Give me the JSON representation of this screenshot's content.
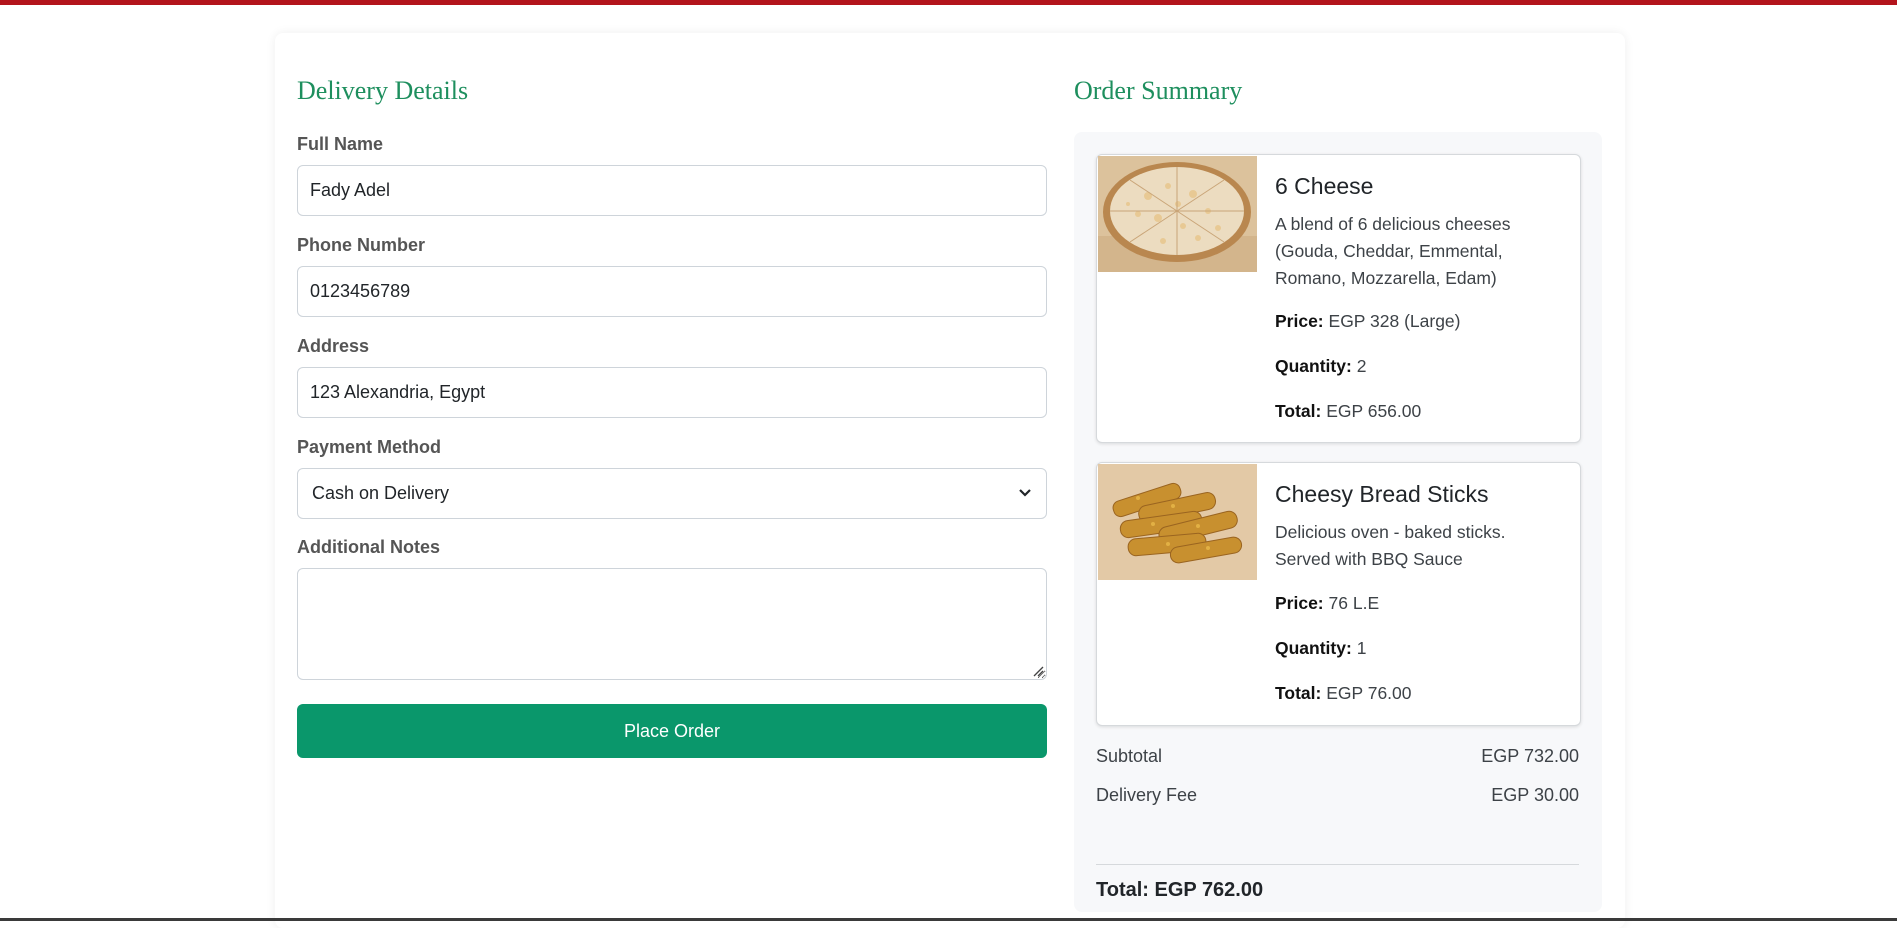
{
  "delivery": {
    "title": "Delivery Details",
    "full_name_label": "Full Name",
    "full_name_value": "Fady Adel",
    "phone_label": "Phone Number",
    "phone_value": "0123456789",
    "address_label": "Address",
    "address_value": "123 Alexandria, Egypt",
    "payment_label": "Payment Method",
    "payment_selected": "Cash on Delivery",
    "notes_label": "Additional Notes",
    "notes_value": "",
    "place_order_label": "Place Order"
  },
  "summary": {
    "title": "Order Summary",
    "items": [
      {
        "name": "6 Cheese",
        "description": "A blend of 6 delicious cheeses (Gouda, Cheddar, Emmental, Romano, Mozzarella, Edam)",
        "price_label": "Price:",
        "price": "EGP 328 (Large)",
        "quantity_label": "Quantity:",
        "quantity": "2",
        "total_label": "Total:",
        "total": "EGP 656.00"
      },
      {
        "name": "Cheesy Bread Sticks",
        "description": "Delicious oven - baked sticks. Served with BBQ Sauce",
        "price_label": "Price:",
        "price": "76 L.E",
        "quantity_label": "Quantity:",
        "quantity": "1",
        "total_label": "Total:",
        "total": "EGP 76.00"
      }
    ],
    "subtotal_label": "Subtotal",
    "subtotal_value": "EGP 732.00",
    "delivery_fee_label": "Delivery Fee",
    "delivery_fee_value": "EGP 30.00",
    "grand_total": "Total: EGP 762.00"
  },
  "colors": {
    "accent_green": "#0a976b",
    "title_green": "#1e8f5e",
    "top_bar_red": "#b3141c"
  }
}
